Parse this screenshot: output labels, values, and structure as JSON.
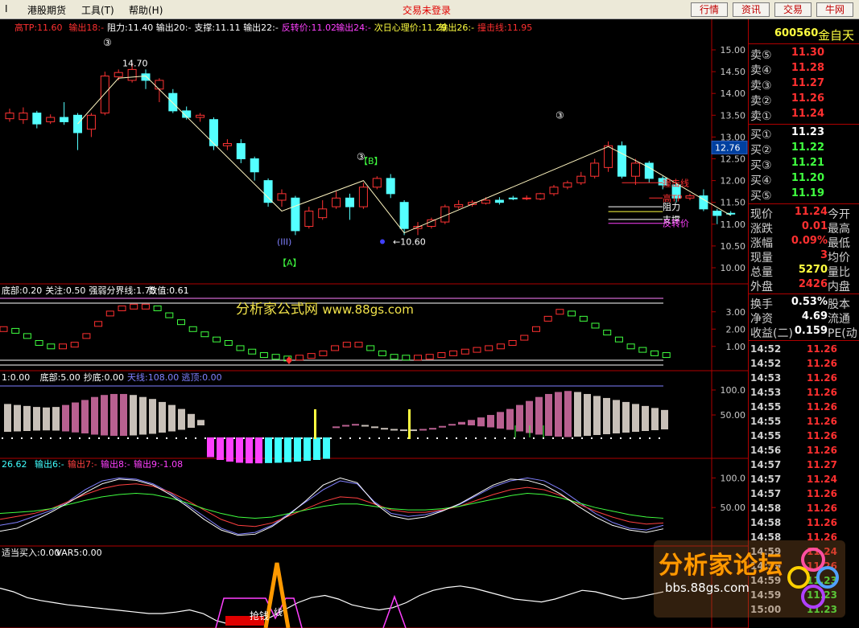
{
  "menu": [
    {
      "id": "close",
      "label": "Ⅰ"
    },
    {
      "id": "hk",
      "label": "港股期货"
    },
    {
      "id": "tools",
      "label": "工具(T)"
    },
    {
      "id": "help",
      "label": "帮助(H)"
    }
  ],
  "trade_status": "交易未登录",
  "top_buttons": [
    "行情",
    "资讯",
    "交易",
    "牛网"
  ],
  "main_panel": {
    "legend": [
      {
        "text": "高TP:11.60",
        "color": "#ff3030"
      },
      {
        "text": "输出18:-",
        "color": "#ff3030"
      },
      {
        "text": "阻力:11.40",
        "color": "#ffffff"
      },
      {
        "text": "输出20:-",
        "color": "#ffffff"
      },
      {
        "text": "支撑:11.11",
        "color": "#ffffff"
      },
      {
        "text": "输出22:-",
        "color": "#ffffff"
      },
      {
        "text": "反转价:11.02",
        "color": "#ff40ff"
      },
      {
        "text": "输出24:-",
        "color": "#ff40ff"
      },
      {
        "text": "次日心理价:11.29",
        "color": "#ffff40"
      },
      {
        "text": "输出26:-",
        "color": "#ffff40"
      },
      {
        "text": "撞击线:11.95",
        "color": "#ff3030"
      }
    ],
    "y_ticks": [
      "15.00",
      "14.50",
      "14.00",
      "13.50",
      "13.00",
      "12.50",
      "12.00",
      "11.50",
      "11.00",
      "10.50",
      "10.00"
    ],
    "crosshair_price": "12.76",
    "annotations": {
      "high_label": "14.70",
      "low_label": "←10.60",
      "wave_a": "【A】",
      "wave_b": "【B】",
      "wave_iii": "(III)",
      "circ3": "③"
    },
    "right_labels": [
      {
        "text": "撞击线",
        "color": "#ff3030"
      },
      {
        "text": "高TP",
        "color": "#ff3030"
      },
      {
        "text": "阻力",
        "color": "#ffffff"
      },
      {
        "text": "支撑",
        "color": "#ffffff"
      },
      {
        "text": "反转价",
        "color": "#ff40ff"
      }
    ]
  },
  "panel2": {
    "legend": [
      {
        "text": "底部:0.20",
        "color": "#ffffff"
      },
      {
        "text": "关注:0.50",
        "color": "#ffffff"
      },
      {
        "text": "强弱分界线:1.75",
        "color": "#ffffff"
      },
      {
        "text": "数值:0.61",
        "color": "#ffffff"
      }
    ],
    "y_ticks": [
      "3.00",
      "2.00",
      "1.00"
    ]
  },
  "panel3": {
    "legend": [
      {
        "text": "1:0.00",
        "color": "#ffffff"
      },
      {
        "text": "底部:5.00",
        "color": "#ffffff"
      },
      {
        "text": "抄底:0.00",
        "color": "#ffffff"
      },
      {
        "text": "天线:108.00",
        "color": "#8080ff"
      },
      {
        "text": "逃顶:0.00",
        "color": "#8080ff"
      }
    ],
    "y_ticks": [
      "100.0",
      "50.00"
    ]
  },
  "panel4": {
    "legend": [
      {
        "text": "26.62",
        "color": "#40ffff"
      },
      {
        "text": "输出6:-",
        "color": "#40ffff"
      },
      {
        "text": "输出7:-",
        "color": "#ff4040"
      },
      {
        "text": "输出8:-",
        "color": "#ff40ff"
      },
      {
        "text": "输出9:-1.08",
        "color": "#ff40ff"
      }
    ],
    "y_ticks": [
      "100.0",
      "50.00"
    ]
  },
  "panel5": {
    "legend": [
      {
        "text": "适当买入:0.00",
        "color": "#ffffff"
      },
      {
        "text": "VAR5:0.00",
        "color": "#ffffff"
      }
    ],
    "label_grab": "抢钱",
    "label_line": "线"
  },
  "watermark": {
    "site": "分析家公式网",
    "url": "www.88gs.com",
    "forum": "分析家论坛",
    "forum_url": "bbs.88gs.com"
  },
  "quote": {
    "code": "600560",
    "name": "金自天",
    "sell": [
      {
        "label": "卖⑤",
        "price": "11.30"
      },
      {
        "label": "卖④",
        "price": "11.28"
      },
      {
        "label": "卖③",
        "price": "11.27"
      },
      {
        "label": "卖②",
        "price": "11.26"
      },
      {
        "label": "卖①",
        "price": "11.24"
      }
    ],
    "buy": [
      {
        "label": "买①",
        "price": "11.23"
      },
      {
        "label": "买②",
        "price": "11.22"
      },
      {
        "label": "买③",
        "price": "11.21"
      },
      {
        "label": "买④",
        "price": "11.20"
      },
      {
        "label": "买⑤",
        "price": "11.19"
      }
    ],
    "stats": [
      {
        "label": "现价",
        "value": "11.24",
        "color": "#ff3030",
        "label2": "今开"
      },
      {
        "label": "涨跌",
        "value": "0.01",
        "color": "#ff3030",
        "label2": "最高"
      },
      {
        "label": "涨幅",
        "value": "0.09%",
        "color": "#ff3030",
        "label2": "最低"
      },
      {
        "label": "现量",
        "value": "3",
        "color": "#ff3030",
        "label2": "均价"
      },
      {
        "label": "总量",
        "value": "5270",
        "color": "#ffff40",
        "label2": "量比"
      },
      {
        "label": "外盘",
        "value": "2426",
        "color": "#ff3030",
        "label2": "内盘"
      }
    ],
    "stats2": [
      {
        "label": "换手",
        "value": "0.53%",
        "color": "#ffffff",
        "label2": "股本"
      },
      {
        "label": "净资",
        "value": "4.69",
        "color": "#ffffff",
        "label2": "流通"
      },
      {
        "label": "收益(二)",
        "value": "0.159",
        "color": "#ffffff",
        "label2": "PE(动"
      }
    ],
    "ticks": [
      {
        "time": "14:52",
        "price": "11.26",
        "color": "#ff3030"
      },
      {
        "time": "14:52",
        "price": "11.26",
        "color": "#ff3030"
      },
      {
        "time": "14:53",
        "price": "11.26",
        "color": "#ff3030"
      },
      {
        "time": "14:53",
        "price": "11.26",
        "color": "#ff3030"
      },
      {
        "time": "14:55",
        "price": "11.26",
        "color": "#ff3030"
      },
      {
        "time": "14:55",
        "price": "11.26",
        "color": "#ff3030"
      },
      {
        "time": "14:55",
        "price": "11.26",
        "color": "#ff3030"
      },
      {
        "time": "14:56",
        "price": "11.26",
        "color": "#ff3030"
      },
      {
        "time": "14:57",
        "price": "11.27",
        "color": "#ff3030"
      },
      {
        "time": "14:57",
        "price": "11.24",
        "color": "#ff3030"
      },
      {
        "time": "14:57",
        "price": "11.26",
        "color": "#ff3030"
      },
      {
        "time": "14:58",
        "price": "11.26",
        "color": "#ff3030"
      },
      {
        "time": "14:58",
        "price": "11.26",
        "color": "#ff3030"
      },
      {
        "time": "14:58",
        "price": "11.26",
        "color": "#ff3030"
      },
      {
        "time": "14:59",
        "price": "11.24",
        "color": "#ff3030"
      },
      {
        "time": "14:59",
        "price": "11.26",
        "color": "#ff3030"
      },
      {
        "time": "14:59",
        "price": "11.23",
        "color": "#40ff40"
      },
      {
        "time": "14:59",
        "price": "11.23",
        "color": "#40ff40"
      },
      {
        "time": "15:00",
        "price": "11.23",
        "color": "#40ff40"
      }
    ]
  },
  "candles": [
    {
      "o": 13.42,
      "c": 13.55,
      "h": 13.65,
      "l": 13.35
    },
    {
      "o": 13.4,
      "c": 13.55,
      "h": 13.68,
      "l": 13.3
    },
    {
      "o": 13.55,
      "c": 13.3,
      "h": 13.6,
      "l": 13.2
    },
    {
      "o": 13.35,
      "c": 13.45,
      "h": 13.52,
      "l": 13.3
    },
    {
      "o": 13.45,
      "c": 13.35,
      "h": 13.8,
      "l": 13.28
    },
    {
      "o": 13.5,
      "c": 13.1,
      "h": 13.55,
      "l": 12.7
    },
    {
      "o": 13.18,
      "c": 13.5,
      "h": 13.55,
      "l": 13.0
    },
    {
      "o": 13.55,
      "c": 14.4,
      "h": 14.5,
      "l": 13.5
    },
    {
      "o": 14.38,
      "c": 14.48,
      "h": 14.55,
      "l": 14.3
    },
    {
      "o": 14.3,
      "c": 14.55,
      "h": 14.7,
      "l": 14.25
    },
    {
      "o": 14.45,
      "c": 14.3,
      "h": 14.55,
      "l": 14.1
    },
    {
      "o": 14.1,
      "c": 14.3,
      "h": 14.35,
      "l": 13.8
    },
    {
      "o": 14.0,
      "c": 13.6,
      "h": 14.1,
      "l": 13.55
    },
    {
      "o": 13.6,
      "c": 13.45,
      "h": 13.7,
      "l": 13.4
    },
    {
      "o": 13.45,
      "c": 13.5,
      "h": 13.55,
      "l": 13.35
    },
    {
      "o": 13.4,
      "c": 12.8,
      "h": 13.45,
      "l": 12.7
    },
    {
      "o": 12.8,
      "c": 12.85,
      "h": 12.95,
      "l": 12.7
    },
    {
      "o": 12.85,
      "c": 12.5,
      "h": 12.95,
      "l": 12.4
    },
    {
      "o": 12.5,
      "c": 12.2,
      "h": 12.55,
      "l": 12.0
    },
    {
      "o": 12.0,
      "c": 11.5,
      "h": 12.05,
      "l": 11.4
    },
    {
      "o": 11.55,
      "c": 11.7,
      "h": 11.8,
      "l": 11.4
    },
    {
      "o": 11.6,
      "c": 10.85,
      "h": 11.65,
      "l": 10.75
    },
    {
      "o": 10.95,
      "c": 11.3,
      "h": 11.4,
      "l": 10.9
    },
    {
      "o": 11.15,
      "c": 11.35,
      "h": 11.55,
      "l": 11.1
    },
    {
      "o": 11.4,
      "c": 11.6,
      "h": 11.75,
      "l": 11.35
    },
    {
      "o": 11.6,
      "c": 11.4,
      "h": 11.7,
      "l": 11.1
    },
    {
      "o": 11.4,
      "c": 11.85,
      "h": 11.95,
      "l": 11.35
    },
    {
      "o": 11.85,
      "c": 12.05,
      "h": 12.1,
      "l": 11.8
    },
    {
      "o": 12.05,
      "c": 11.7,
      "h": 12.15,
      "l": 11.6
    },
    {
      "o": 11.5,
      "c": 10.9,
      "h": 11.55,
      "l": 10.75
    },
    {
      "o": 10.9,
      "c": 10.95,
      "h": 11.05,
      "l": 10.75
    },
    {
      "o": 10.95,
      "c": 11.1,
      "h": 11.15,
      "l": 10.9
    },
    {
      "o": 11.05,
      "c": 11.4,
      "h": 11.45,
      "l": 11.0
    },
    {
      "o": 11.4,
      "c": 11.45,
      "h": 11.55,
      "l": 11.35
    },
    {
      "o": 11.45,
      "c": 11.5,
      "h": 11.55,
      "l": 11.4
    },
    {
      "o": 11.48,
      "c": 11.55,
      "h": 11.62,
      "l": 11.45
    },
    {
      "o": 11.55,
      "c": 11.5,
      "h": 11.62,
      "l": 11.45
    },
    {
      "o": 11.6,
      "c": 11.58,
      "h": 11.65,
      "l": 11.55
    },
    {
      "o": 11.6,
      "c": 11.6,
      "h": 11.66,
      "l": 11.55
    },
    {
      "o": 11.58,
      "c": 11.7,
      "h": 11.72,
      "l": 11.55
    },
    {
      "o": 11.7,
      "c": 11.85,
      "h": 11.9,
      "l": 11.65
    },
    {
      "o": 11.85,
      "c": 11.95,
      "h": 12.0,
      "l": 11.8
    },
    {
      "o": 11.95,
      "c": 12.1,
      "h": 12.2,
      "l": 11.9
    },
    {
      "o": 12.1,
      "c": 12.4,
      "h": 12.5,
      "l": 12.05
    },
    {
      "o": 12.3,
      "c": 12.8,
      "h": 12.9,
      "l": 12.2
    },
    {
      "o": 12.8,
      "c": 12.1,
      "h": 12.9,
      "l": 12.05
    },
    {
      "o": 12.1,
      "c": 12.4,
      "h": 12.5,
      "l": 11.9
    },
    {
      "o": 12.4,
      "c": 12.05,
      "h": 12.45,
      "l": 11.95
    },
    {
      "o": 12.05,
      "c": 11.9,
      "h": 12.1,
      "l": 11.8
    },
    {
      "o": 11.9,
      "c": 11.6,
      "h": 11.95,
      "l": 11.5
    },
    {
      "o": 11.6,
      "c": 11.65,
      "h": 11.7,
      "l": 11.55
    },
    {
      "o": 11.65,
      "c": 11.35,
      "h": 11.8,
      "l": 11.3
    },
    {
      "o": 11.3,
      "c": 11.2,
      "h": 11.35,
      "l": 11.0
    },
    {
      "o": 11.25,
      "c": 11.24,
      "h": 11.3,
      "l": 11.2
    }
  ]
}
